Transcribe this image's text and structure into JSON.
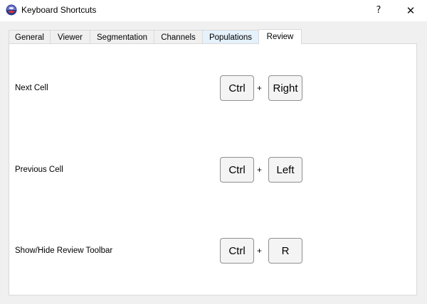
{
  "window": {
    "title": "Keyboard Shortcuts",
    "help_label": "?",
    "close_label": "✕"
  },
  "tabs": [
    {
      "label": "General"
    },
    {
      "label": "Viewer"
    },
    {
      "label": "Segmentation"
    },
    {
      "label": "Channels"
    },
    {
      "label": "Populations"
    },
    {
      "label": "Review"
    }
  ],
  "active_tab": "Review",
  "shortcuts": [
    {
      "label": "Next Cell",
      "keys": [
        "Ctrl",
        "Right"
      ]
    },
    {
      "label": "Previous Cell",
      "keys": [
        "Ctrl",
        "Left"
      ]
    },
    {
      "label": "Show/Hide Review Toolbar",
      "keys": [
        "Ctrl",
        "R"
      ]
    }
  ],
  "plus_symbol": "+",
  "colors": {
    "panel_bg": "#ffffff",
    "window_bg": "#f0f0f0",
    "tab_hover": "#e5f1fb",
    "border": "#d9d9d9",
    "key_border": "#8f8f8f"
  }
}
